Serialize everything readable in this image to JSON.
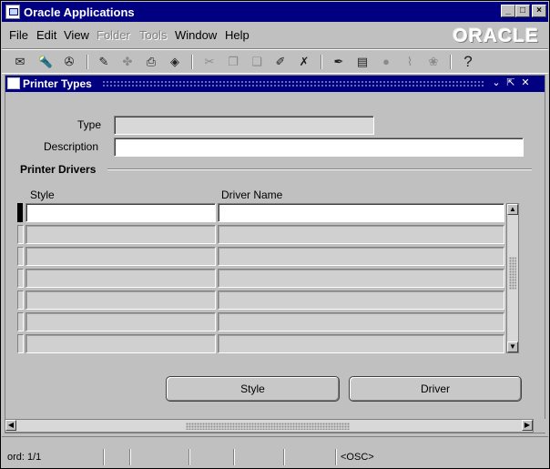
{
  "window": {
    "title": "Oracle Applications",
    "minimize": "_",
    "maximize": "□",
    "close": "×"
  },
  "menu": {
    "items": [
      {
        "label": "File",
        "enabled": true
      },
      {
        "label": "Edit",
        "enabled": true
      },
      {
        "label": "View",
        "enabled": true
      },
      {
        "label": "Folder",
        "enabled": false
      },
      {
        "label": "Tools",
        "enabled": false
      },
      {
        "label": "Window",
        "enabled": true
      },
      {
        "label": "Help",
        "enabled": true
      }
    ],
    "logo": "ORACLE"
  },
  "toolbar": {
    "buttons": [
      {
        "icon": "new-icon",
        "glyph": "✉",
        "enabled": true
      },
      {
        "icon": "find-icon",
        "glyph": "🔦",
        "enabled": true
      },
      {
        "icon": "navigator-icon",
        "glyph": "✇",
        "enabled": true
      },
      {
        "icon": "save-icon",
        "glyph": "✎",
        "enabled": true
      },
      {
        "icon": "next-step-icon",
        "glyph": "✤",
        "enabled": false
      },
      {
        "icon": "print-icon",
        "glyph": "⎙",
        "enabled": true
      },
      {
        "icon": "close-form-icon",
        "glyph": "◈",
        "enabled": true
      },
      {
        "icon": "cut-icon",
        "glyph": "✂",
        "enabled": false
      },
      {
        "icon": "copy-icon",
        "glyph": "❐",
        "enabled": false
      },
      {
        "icon": "paste-icon",
        "glyph": "❏",
        "enabled": false
      },
      {
        "icon": "new-record-icon",
        "glyph": "✐",
        "enabled": true
      },
      {
        "icon": "delete-record-icon",
        "glyph": "✗",
        "enabled": true
      },
      {
        "icon": "edit-field-icon",
        "glyph": "✒",
        "enabled": true
      },
      {
        "icon": "zoom-icon",
        "glyph": "▤",
        "enabled": true
      },
      {
        "icon": "translations-icon",
        "glyph": "●",
        "enabled": false
      },
      {
        "icon": "attachments-icon",
        "glyph": "⌇",
        "enabled": false
      },
      {
        "icon": "folder-tools-icon",
        "glyph": "❀",
        "enabled": false
      },
      {
        "icon": "help-icon",
        "glyph": "?",
        "enabled": true
      }
    ]
  },
  "form": {
    "title": "Printer Types",
    "type_label": "Type",
    "type_value": "",
    "description_label": "Description",
    "description_value": "",
    "section_title": "Printer Drivers",
    "columns": [
      "Style",
      "Driver Name"
    ],
    "rows": [
      {
        "style": "",
        "driver_name": ""
      },
      {
        "style": "",
        "driver_name": ""
      },
      {
        "style": "",
        "driver_name": ""
      },
      {
        "style": "",
        "driver_name": ""
      },
      {
        "style": "",
        "driver_name": ""
      },
      {
        "style": "",
        "driver_name": ""
      },
      {
        "style": "",
        "driver_name": ""
      }
    ],
    "style_button": "Style",
    "driver_button": "Driver"
  },
  "statusbar": {
    "record": "ord: 1/1",
    "osc": "<OSC>"
  }
}
